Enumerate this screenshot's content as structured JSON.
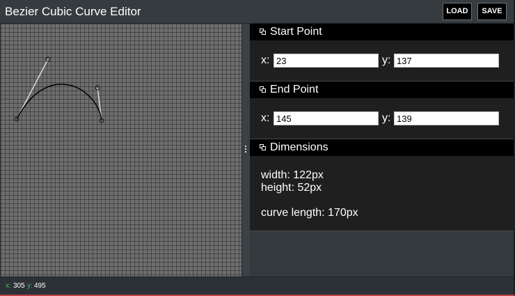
{
  "app": {
    "title": "Bezier Cubic Curve Editor",
    "load_label": "LOAD",
    "save_label": "SAVE"
  },
  "start_point": {
    "header": "Start Point",
    "x_label": "x:",
    "x_value": "23",
    "y_label": "y:",
    "y_value": "137"
  },
  "end_point": {
    "header": "End Point",
    "x_label": "x:",
    "x_value": "145",
    "y_label": "y:",
    "y_value": "139"
  },
  "dimensions": {
    "header": "Dimensions",
    "width_text": "width: 122px",
    "height_text": "height: 52px",
    "curve_length_text": "curve length: 170px"
  },
  "curve": {
    "start": [
      23,
      137
    ],
    "control1": [
      68,
      51
    ],
    "control2": [
      139,
      92
    ],
    "end": [
      145,
      139
    ],
    "stroke_color": "#000000",
    "handle_color": "#dcdcdc"
  },
  "status": {
    "x_label": "x:",
    "x_value": "305",
    "y_label": "y:",
    "y_value": "495"
  },
  "icons": {
    "section_icon": "collapse-icon",
    "splitter_icon": "grip-icon"
  }
}
